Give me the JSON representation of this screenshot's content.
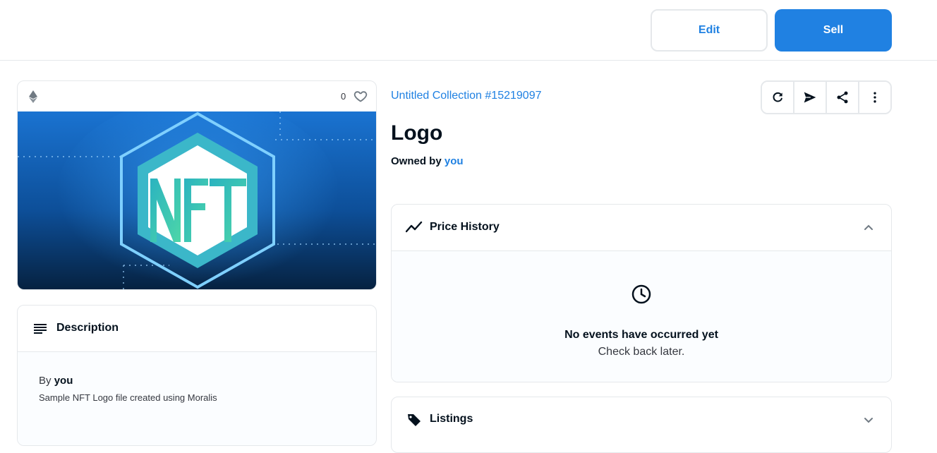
{
  "header": {
    "edit_label": "Edit",
    "sell_label": "Sell"
  },
  "media": {
    "like_count": "0",
    "image_text": "NFT"
  },
  "description": {
    "title": "Description",
    "by_prefix": "By",
    "by_owner": "you",
    "text": "Sample NFT Logo file created using Moralis"
  },
  "item": {
    "collection": "Untitled Collection #15219097",
    "title": "Logo",
    "owned_prefix": "Owned by",
    "owner": "you"
  },
  "actions": [
    "refresh-icon",
    "send-icon",
    "share-icon",
    "more-icon"
  ],
  "price_history": {
    "title": "Price History",
    "empty_title": "No events have occurred yet",
    "empty_sub": "Check back later."
  },
  "listings": {
    "title": "Listings"
  },
  "colors": {
    "accent": "#2081e2",
    "text": "#04111d",
    "border": "#e5e8eb"
  }
}
